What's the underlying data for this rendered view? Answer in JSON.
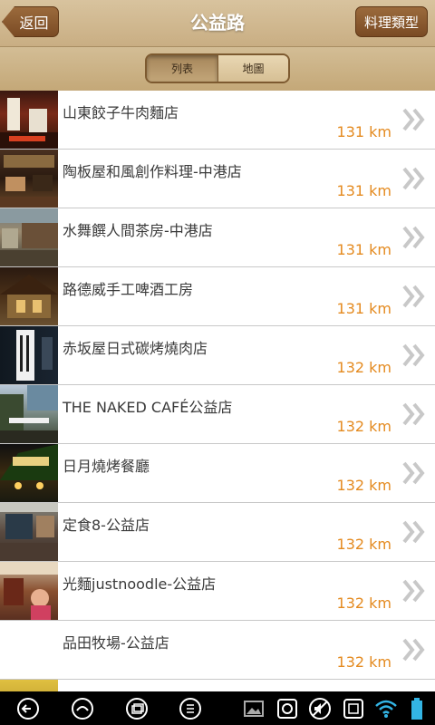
{
  "header": {
    "back_label": "返回",
    "title": "公益路",
    "type_label": "料理類型"
  },
  "segment": {
    "list_label": "列表",
    "map_label": "地圖"
  },
  "restaurants": [
    {
      "name": "山東餃子牛肉麵店",
      "distance": "131 km"
    },
    {
      "name": "陶板屋和風創作料理-中港店",
      "distance": "131 km"
    },
    {
      "name": "水舞饌人間茶房-中港店",
      "distance": "131 km"
    },
    {
      "name": "路德威手工啤酒工房",
      "distance": "131 km"
    },
    {
      "name": "赤坂屋日式碳烤燒肉店",
      "distance": "132 km"
    },
    {
      "name": "THE NAKED CAFÉ公益店",
      "distance": "132 km"
    },
    {
      "name": "日月燒烤餐廳",
      "distance": "132 km"
    },
    {
      "name": "定食8-公益店",
      "distance": "132 km"
    },
    {
      "name": "光麵justnoodle-公益店",
      "distance": "132 km"
    },
    {
      "name": "品田牧場-公益店",
      "distance": "132 km"
    }
  ],
  "colors": {
    "distance": "#e48a1f",
    "header_button": "#7a4b24",
    "header_bg": "#d8c39e"
  },
  "system_icons": [
    "back-icon",
    "home-icon",
    "recent-apps-icon",
    "menu-icon",
    "gallery-icon",
    "screenshot-icon",
    "mute-icon",
    "capture-icon",
    "wifi-icon",
    "battery-icon"
  ]
}
